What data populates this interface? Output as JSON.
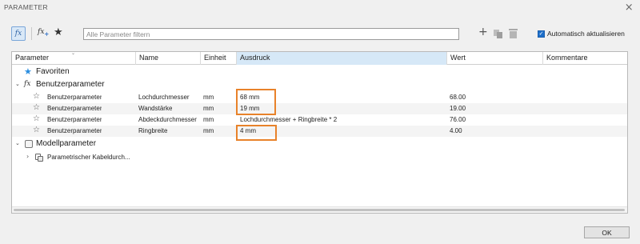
{
  "window": {
    "title": "PARAMETER",
    "close": "×"
  },
  "toolbar": {
    "fx_label": "fx",
    "add_fx_label": "fx",
    "add_fx_sub": "+",
    "star_icon": "★",
    "filter_placeholder": "Alle Parameter filtern",
    "plus_icon": "+",
    "auto_update_label": "Automatisch aktualisieren",
    "auto_update_checked": true
  },
  "table": {
    "columns": [
      "Parameter",
      "Name",
      "Einheit",
      "Ausdruck",
      "Wert",
      "Kommentare"
    ],
    "active_column": "Ausdruck",
    "groups": {
      "favorites": "Favoriten",
      "user": "Benutzerparameter",
      "model": "Modellparameter"
    },
    "rows": [
      {
        "parameter": "Benutzerparameter",
        "name": "Lochdurchmesser",
        "unit": "mm",
        "expression": "68 mm",
        "value": "68.00",
        "highlighted": true
      },
      {
        "parameter": "Benutzerparameter",
        "name": "Wandstärke",
        "unit": "mm",
        "expression": "19 mm",
        "value": "19.00",
        "highlighted": true
      },
      {
        "parameter": "Benutzerparameter",
        "name": "Abdeckdurchmesser",
        "unit": "mm",
        "expression": "Lochdurchmesser + Ringbreite * 2",
        "value": "76.00",
        "highlighted": false
      },
      {
        "parameter": "Benutzerparameter",
        "name": "Ringbreite",
        "unit": "mm",
        "expression": "4 mm",
        "value": "4.00",
        "highlighted": true
      }
    ],
    "model_children": [
      {
        "label": "Parametrischer Kabeldurch..."
      }
    ]
  },
  "highlight_color": "#e8822a",
  "footer": {
    "ok_label": "OK"
  }
}
